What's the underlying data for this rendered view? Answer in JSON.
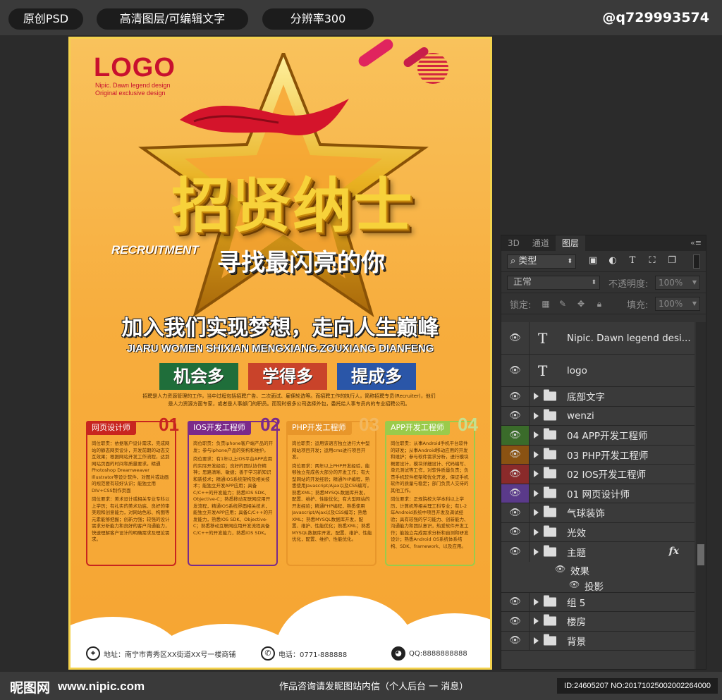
{
  "top_bar": {
    "pill_1": "原创PSD",
    "pill_2": "高清图层/可编辑文字",
    "pill_3": "分辨率300",
    "handle": "@q729993574"
  },
  "poster": {
    "logo": "LOGO",
    "logo_sub_1": "Nipic. Dawn legend design",
    "logo_sub_2": "Original exclusive design",
    "title": "招贤纳士",
    "recruit_en": "RECRUITMENT",
    "subtitle": "寻找最闪亮的你",
    "slogan": "加入我们实现梦想，走向人生巅峰",
    "pinyin": "JIARU WOMEN SHIXIAN MENGXIANG.ZOUXIANG DIANFENG",
    "badges": [
      {
        "label": "机会多",
        "color": "#1f6e3a"
      },
      {
        "label": "学得多",
        "color": "#c9432a"
      },
      {
        "label": "提成多",
        "color": "#2a56a8"
      }
    ],
    "intro": "招聘是人力资源管理的工作，当中过程包括招聘广告、二次面试、雇佣轮选等。而招聘工作的执行人，简称招聘专员(Recruiter)，他们是人力资源方面专家，或者是人事部门的职员。而现时很多公司选择外包，委托给人事专员内的专业招聘公司。",
    "cards": [
      {
        "title": "网页设计师",
        "num": "01",
        "color": "#c8251f",
        "p1": "岗位职责：依据客户设计需求，完成网站的静态网页设计，开发前期的动态交互效果；根据网站开发工作流程，达到网站页面的时间和质量要求。精通Photoshop Dreamweaver Illustrator等设计软件，对图片或动画的规范要有较好认识；能独立用DIV+CSS制作页面",
        "p2": "岗位要求：美术设计或相关专业专科以上学历；有扎实的美术功底、良好的审美观和创意能力，对网站色彩、构图等元素能够把握；创新力强；较强的设计需求分析能力和良好的客户沟通能力，快速理解客户设计的明确需求及理论需求。"
      },
      {
        "title": "IOS开发工程师",
        "num": "02",
        "color": "#7b2a8a",
        "p1": "岗位职责：负责iphone客户端产品的开发；参与iphone产品的架构和维护。",
        "p2": "岗位要求：有1年以上IOS平台APP应用的实际开发经验；良好的团队协作精神；思路清晰、敏捷；善于学习新知识和新技术；精通IOS系统架构及相关技术；能独立开发APP应用；具备C/C++的开发能力；熟悉IOS SDK、Objective-C；熟悉移动互联网应用开发流程，精通IOS系统界面相关技术，能独立开发APP应用；具备C/C++的开发能力，熟悉IOS SDK、Objective-C；熟悉移动互联网应用开发流程具备C/C++的开发能力，熟悉IOS SDK。"
      },
      {
        "title": "PHP开发工程师",
        "num": "03",
        "color": "#e8962a",
        "p1": "岗位职责：运用该语言独立进行大中型网站项目开发；运用cms进行项目开发。",
        "p2": "岗位要求：两年以上PHP开发经验，能够独立完成各大部分的开发工作；有大型网站的开发经验；精通PHP编程，熟悉使用Javascript/Ajax以及CSS编写，熟悉XML；熟悉MYSQL数据库开发，配置、维护、性能优化；有大型网站的开发经验；精通PHP编程，熟悉使用Javascript/Ajax以及CSS编写；熟悉XML；熟悉MYSQL数据库开发，配置、维护、性能优化；熟悉XML；熟悉MYSQL数据库开发，配置、维护、性能优化，配置、维护、性能优化。"
      },
      {
        "title": "APP开发工程师",
        "num": "04",
        "color": "#9acb4b",
        "p1": "岗位职责：从事Android手机平台软件的研发；从事Android移动应用的开发和维护；参与软件需求分析，进行模块概要设计，模块详细设计、代码编写、单元测试等工作，对软件质量负责；负责手机软件框架和优化开发，保证手机软件的质量与稳定；部门负责人交待的其他工作。",
        "p2": "岗位要求：正规院校大学本科以上学历，计算机等相关理工科专业；有1-2年Android系统中项目开发及调试经验；具有较强的学习能力、创新能力、沟通能力和团队意识，热爱软件开发工作；能独立完成需求分析和自测和研发设计；熟悉Android OS系统体系结构、SDK、framework、以及应用。"
      }
    ],
    "contact": {
      "address": "地址：南宁市青秀区XX街道XX号一楼商铺",
      "phone": "电话：0771-888888",
      "qq": "QQ:8888888888"
    }
  },
  "layers_panel": {
    "tabs": [
      "3D",
      "通道",
      "图层"
    ],
    "active_tab": "图层",
    "filter_label": "类型",
    "blend_mode": "正常",
    "opacity_label": "不透明度:",
    "opacity_value": "100%",
    "lock_label": "锁定:",
    "fill_label": "填充:",
    "fill_value": "100%",
    "layers": [
      {
        "name": "Nipic. Dawn legend desi...",
        "kind": "text"
      },
      {
        "name": "logo",
        "kind": "text"
      },
      {
        "name": "底部文字",
        "kind": "group"
      },
      {
        "name": "wenzi",
        "kind": "group"
      },
      {
        "name": "04 APP开发工程师",
        "kind": "group",
        "tag_color": "#3a6b2a"
      },
      {
        "name": "03 PHP开发工程师",
        "kind": "group",
        "tag_color": "#8a5212"
      },
      {
        "name": "02 IOS开发工程师",
        "kind": "group",
        "tag_color": "#8a2a2a"
      },
      {
        "name": "01 网页设计师",
        "kind": "group",
        "tag_color": "#5a3a8a"
      },
      {
        "name": "气球装饰",
        "kind": "group"
      },
      {
        "name": "光效",
        "kind": "group"
      },
      {
        "name": "主题",
        "kind": "group",
        "fx": "fx"
      },
      {
        "name": "组 5",
        "kind": "group"
      },
      {
        "name": "楼房",
        "kind": "group"
      },
      {
        "name": "背景",
        "kind": "group"
      }
    ],
    "effects_label": "效果",
    "shadow_label": "投影"
  },
  "bottom_bar": {
    "brand": "昵图网",
    "url": "www.nipic.com",
    "consult": "作品咨询请发昵图站内信（个人后台 一 消息）",
    "id": "ID:24605207 NO:20171025002002264000"
  }
}
